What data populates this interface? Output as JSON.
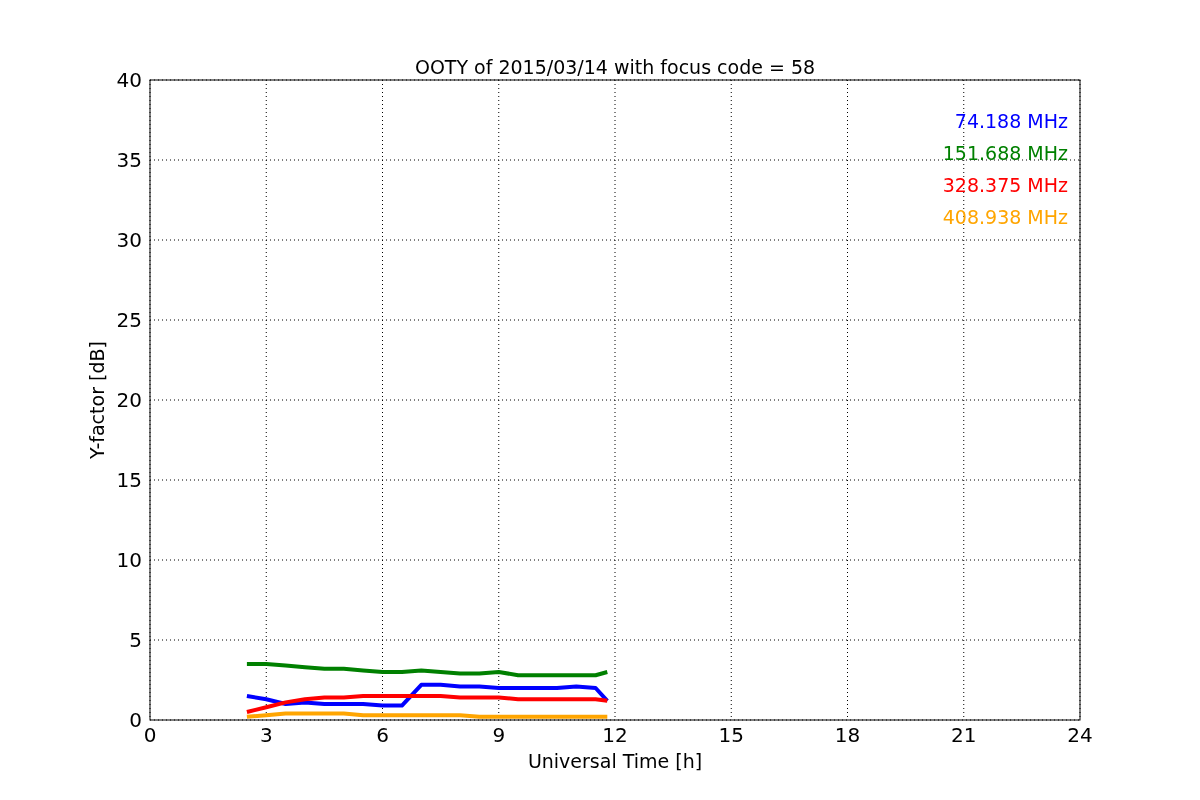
{
  "chart_data": {
    "type": "line",
    "title": "OOTY of 2015/03/14 with focus code = 58",
    "xlabel": "Universal Time [h]",
    "ylabel": "Y-factor [dB]",
    "x": [
      2.5,
      3,
      3.5,
      4,
      4.5,
      5,
      5.5,
      6,
      6.5,
      7,
      7.5,
      8,
      8.5,
      9,
      9.5,
      10,
      10.5,
      11,
      11.5,
      11.8
    ],
    "series": [
      {
        "name": "74.188 MHz",
        "color": "#0000ff",
        "values": [
          1.5,
          1.3,
          1.0,
          1.1,
          1.0,
          1.0,
          1.0,
          0.9,
          0.9,
          2.2,
          2.2,
          2.1,
          2.1,
          2.0,
          2.0,
          2.0,
          2.0,
          2.1,
          2.0,
          1.2
        ]
      },
      {
        "name": "151.688 MHz",
        "color": "#008000",
        "values": [
          3.5,
          3.5,
          3.4,
          3.3,
          3.2,
          3.2,
          3.1,
          3.0,
          3.0,
          3.1,
          3.0,
          2.9,
          2.9,
          3.0,
          2.8,
          2.8,
          2.8,
          2.8,
          2.8,
          3.0
        ]
      },
      {
        "name": "328.375 MHz",
        "color": "#ff0000",
        "values": [
          0.5,
          0.8,
          1.1,
          1.3,
          1.4,
          1.4,
          1.5,
          1.5,
          1.5,
          1.5,
          1.5,
          1.4,
          1.4,
          1.4,
          1.3,
          1.3,
          1.3,
          1.3,
          1.3,
          1.2
        ]
      },
      {
        "name": "408.938 MHz",
        "color": "#ffa500",
        "values": [
          0.2,
          0.3,
          0.4,
          0.4,
          0.4,
          0.4,
          0.3,
          0.3,
          0.3,
          0.3,
          0.3,
          0.3,
          0.2,
          0.2,
          0.2,
          0.2,
          0.2,
          0.2,
          0.2,
          0.2
        ]
      }
    ],
    "xlim": [
      0,
      24
    ],
    "ylim": [
      0,
      40
    ],
    "xticks": [
      0,
      3,
      6,
      9,
      12,
      15,
      18,
      21,
      24
    ],
    "yticks": [
      0,
      5,
      10,
      15,
      20,
      25,
      30,
      35,
      40
    ],
    "grid": true
  }
}
